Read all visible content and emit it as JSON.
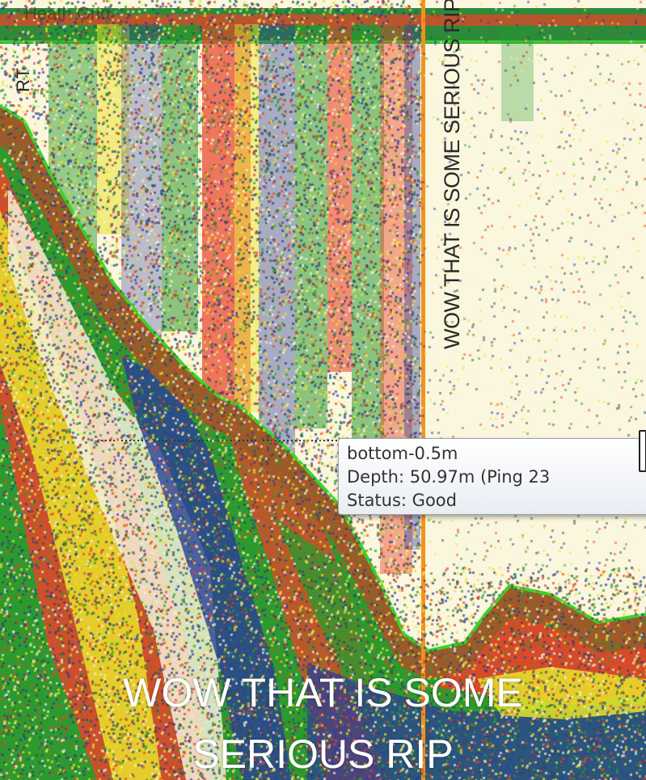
{
  "overlay": {
    "left_label": "RT",
    "top_name": "Heath Grid"
  },
  "annotation": {
    "vertical_text": "WOW THAT IS SOME SERIOUS RIP"
  },
  "tooltip": {
    "line1": "bottom-0.5m",
    "line2": "Depth: 50.97m (Ping 23",
    "line3": "Status: Good"
  },
  "caption": {
    "line1": "WOW THAT IS SOME",
    "line2": "SERIOUS RIP"
  },
  "colors": {
    "background": "#fbf7df",
    "bottom_band": "#9a5a2a",
    "bottom_line": "#39d42a",
    "marker_line": "#f2921e",
    "echo_red": "#e8432a",
    "echo_yellow": "#e9e32a",
    "echo_green": "#2c9a2e",
    "echo_blue": "#2a3d9a"
  }
}
